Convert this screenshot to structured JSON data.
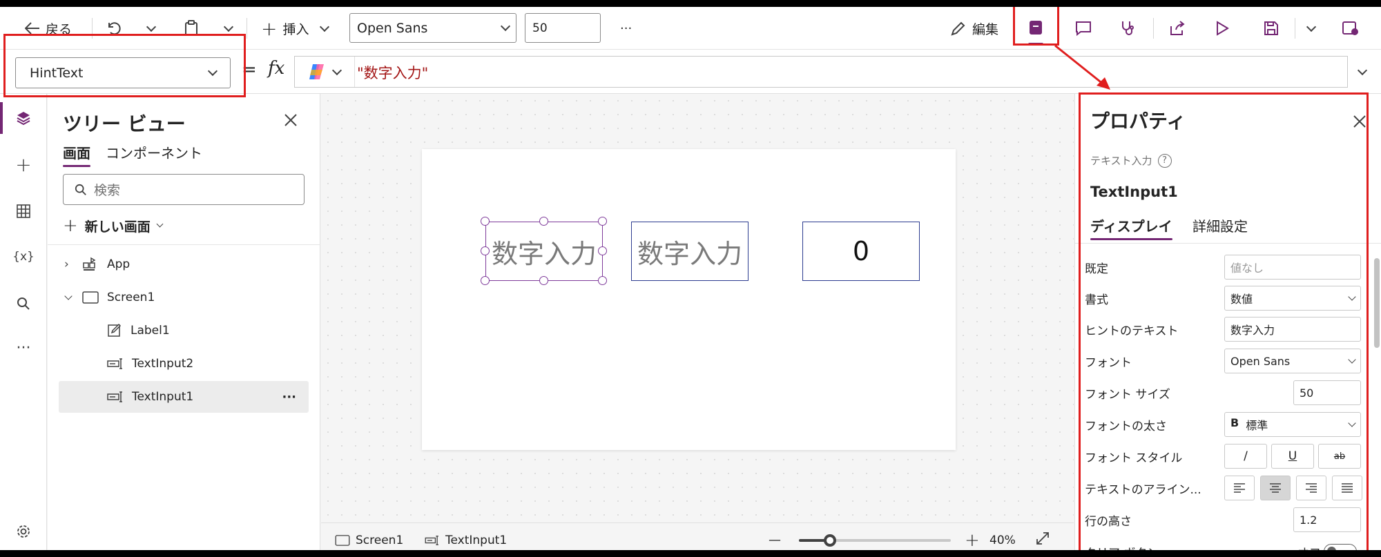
{
  "toolbar": {
    "back_label": "戻る",
    "insert_label": "挿入",
    "font_value": "Open Sans",
    "font_size_value": "50",
    "more_label": "···",
    "edit_label": "編集"
  },
  "formula": {
    "property": "HintText",
    "equals": "=",
    "fx": "fx",
    "expression": "\"数字入力\""
  },
  "tree": {
    "title": "ツリー ビュー",
    "tabs": [
      "画面",
      "コンポーネント"
    ],
    "search_placeholder": "検索",
    "new_screen": "新しい画面",
    "items": [
      {
        "label": "App"
      },
      {
        "label": "Screen1"
      },
      {
        "label": "Label1"
      },
      {
        "label": "TextInput2"
      },
      {
        "label": "TextInput1"
      }
    ],
    "more": "···"
  },
  "canvas": {
    "input1_hint": "数字入力",
    "input2_hint": "数字入力",
    "label_value": "0"
  },
  "statusbar": {
    "screen": "Screen1",
    "control": "TextInput1",
    "zoom": "40%",
    "minus": "—",
    "plus": "+"
  },
  "properties": {
    "title": "プロパティ",
    "control_type": "テキスト入力",
    "control_name": "TextInput1",
    "tabs": [
      "ディスプレイ",
      "詳細設定"
    ],
    "rows": {
      "default_label": "既定",
      "default_placeholder": "値なし",
      "format_label": "書式",
      "format_value": "数値",
      "hint_label": "ヒントのテキスト",
      "hint_value": "数字入力",
      "font_label": "フォント",
      "font_value": "Open Sans",
      "font_size_label": "フォント サイズ",
      "font_size_value": "50",
      "font_weight_label": "フォントの太さ",
      "font_weight_value": "標準",
      "font_weight_prefix": "B",
      "font_style_label": "フォント スタイル",
      "italic": "/",
      "underline": "U",
      "strike": "ab",
      "align_label": "テキストのアライン...",
      "line_height_label": "行の高さ",
      "line_height_value": "1.2",
      "clear_button_label": "クリア ボタン",
      "clear_button_value": "オフ"
    }
  },
  "colors": {
    "accent": "#742774",
    "annotation": "#e01e1e",
    "formula_text": "#a31515"
  }
}
